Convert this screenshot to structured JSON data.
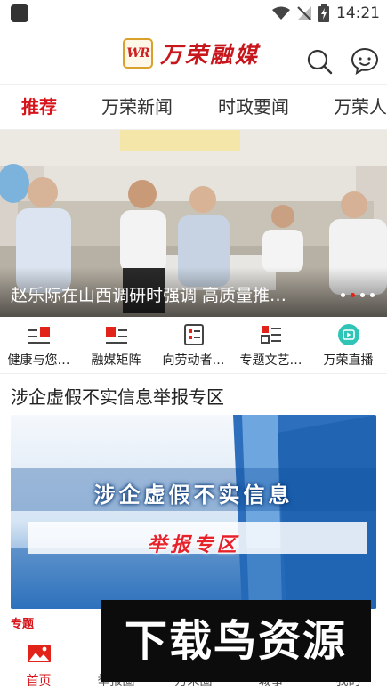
{
  "status_bar": {
    "time": "14:21"
  },
  "header": {
    "logo_mark": "WR",
    "logo_text": "万荣融媒",
    "search_icon": "search-icon",
    "chat_icon": "chat-bubble-icon"
  },
  "tabs": [
    {
      "label": "推荐",
      "active": true
    },
    {
      "label": "万荣新闻",
      "active": false
    },
    {
      "label": "时政要闻",
      "active": false
    },
    {
      "label": "万荣人",
      "active": false
    }
  ],
  "banner": {
    "caption": "赵乐际在山西调研时强调 高质量推…",
    "dots": 4,
    "active_dot": 2
  },
  "quick_entries": [
    {
      "label": "健康与您…",
      "icon": "list-red-icon"
    },
    {
      "label": "融媒矩阵",
      "icon": "list-red-icon"
    },
    {
      "label": "向劳动者…",
      "icon": "document-icon"
    },
    {
      "label": "专题文艺…",
      "icon": "grid-list-icon"
    },
    {
      "label": "万荣直播",
      "icon": "live-play-icon"
    }
  ],
  "section": {
    "title": "涉企虚假不实信息举报专区",
    "image_line_1": "涉企虚假不实信息",
    "image_line_2": "举报专区",
    "tag": "专题"
  },
  "bottom_nav": [
    {
      "label": "首页",
      "active": true,
      "icon": "home-picture-icon"
    },
    {
      "label": "举报圈",
      "active": false,
      "icon": "report-icon"
    },
    {
      "label": "万荣圈",
      "active": false,
      "icon": "circle-icon"
    },
    {
      "label": "城事",
      "active": false,
      "icon": "city-icon"
    },
    {
      "label": "我的",
      "active": false,
      "icon": "profile-icon"
    }
  ],
  "watermark": {
    "text": "下载鸟资源"
  },
  "colors": {
    "accent": "#d7141a",
    "banner_sofa": "#c7c1b8",
    "feature_blue": "#1c5fae"
  }
}
